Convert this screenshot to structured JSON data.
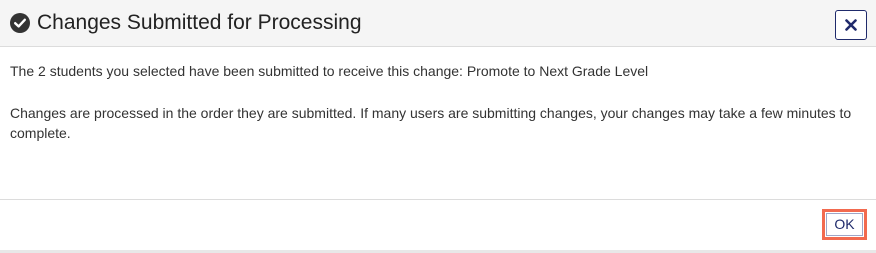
{
  "dialog": {
    "title": "Changes Submitted for Processing",
    "header_icon": "check-circle-icon",
    "close_icon": "close-icon",
    "message_line1": "The 2 students you selected have been submitted to receive this change: Promote to Next Grade Level",
    "message_line2": "Changes are processed in the order they are submitted. If many users are submitting changes, your changes may take a few minutes to complete.",
    "ok_label": "OK"
  },
  "colors": {
    "accent": "#1f2a6b",
    "highlight": "#f26a4f",
    "header_bg": "#f5f5f5"
  }
}
